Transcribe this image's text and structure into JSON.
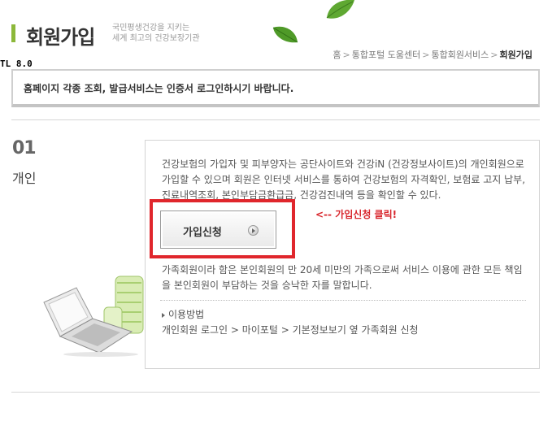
{
  "header": {
    "title": "회원가입",
    "slogan_line1": "국민평생건강을 지키는",
    "slogan_line2": "세계 최고의 건강보장기관"
  },
  "breadcrumb": {
    "items": [
      "홈",
      "통합포털 도움센터",
      "통합회원서비스"
    ],
    "current": "회원가입",
    "separator": ">"
  },
  "tl_label": "TL 8.0",
  "notice": "홈페이지 각종 조회, 발급서비스는 인증서 로그인하시기 바랍니다.",
  "section": {
    "number": "01",
    "label": "개인",
    "description": "건강보험의 가입자 및 피부양자는 공단사이트와 건강iN (건강정보사이트)의 개인회원으로 가입할 수 있으며 회원은 인터넷 서비스를 통하여 건강보험의 자격확인, 보험료 고지 납부, 진료내역조회, 본인부담금환급금, 건강검진내역 등을 확인할 수 있다.",
    "join_button": "가입신청",
    "annotation": "<-- 가입신청 클릭!",
    "family_note": "가족회원이라 함은 본인회원의 만 20세 미만의 가족으로써 서비스 이용에 관한 모든 책임을 본인회원이 부담하는 것을 승낙한 자를 말합니다.",
    "usage_title": "이용방법",
    "usage_path": "개인회원 로그인 > 마이포털 > 기본정보보기 옆 가족회원 신청"
  },
  "colors": {
    "accent_green": "#8cb83a",
    "highlight_red": "#e0262c",
    "annotation_red": "#d8262c"
  },
  "icons": [
    "leaf-icon",
    "arrow-circle-icon",
    "triangle-bullet-icon",
    "laptop-illustration"
  ]
}
